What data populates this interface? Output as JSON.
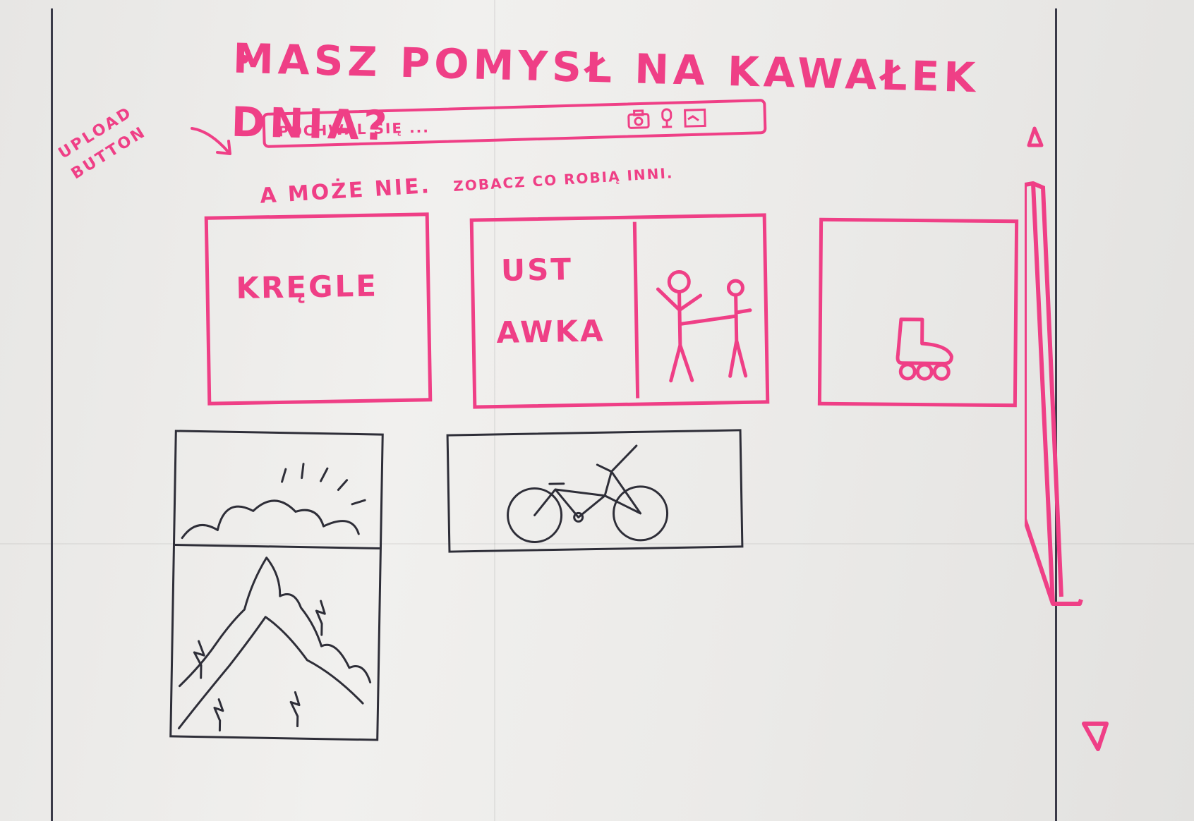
{
  "header": {
    "title": "MASZ POMYSŁ NA KAWAŁEK DNIA?"
  },
  "annotation": {
    "line1": "UPLOAD",
    "line2": "BUTTON"
  },
  "search": {
    "placeholder": "POCHWAL SIĘ ...",
    "icons": [
      "camera-icon",
      "microphone-icon",
      "image-icon"
    ]
  },
  "subtitle": {
    "lead": "A MOŻE NIE.",
    "rest": "ZOBACZ CO ROBIĄ INNI."
  },
  "cards": [
    {
      "label": "KRĘGLE",
      "icon": null
    },
    {
      "label_line1": "UST",
      "label_line2": "AWKA",
      "icon": "people-figures"
    },
    {
      "label": "",
      "icon": "roller-skate-icon"
    }
  ],
  "photos": [
    {
      "icon": "mountains-sun-icon"
    },
    {
      "icon": "bicycle-icon"
    }
  ],
  "colors": {
    "accent": "#ef3f86",
    "ink": "#2e2e38"
  }
}
